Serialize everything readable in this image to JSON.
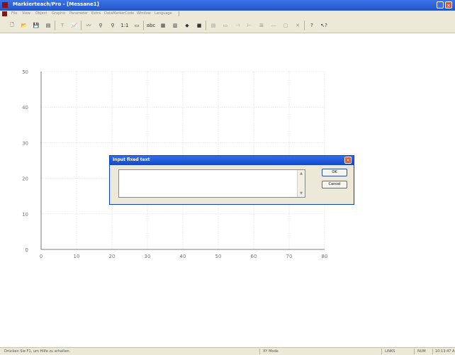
{
  "window": {
    "title": "Markierteach/Pro - [Messane1]",
    "minimize_glyph": "_",
    "close_glyph": "×"
  },
  "menu": {
    "items": [
      "File",
      "View",
      "Object",
      "Graphic",
      "Parameter",
      "Extra",
      "DataMarkerCode",
      "Window",
      "Language"
    ]
  },
  "toolbar": {
    "buttons": [
      {
        "name": "new-icon",
        "glyph": "🗋",
        "enabled": true
      },
      {
        "name": "open-icon",
        "glyph": "📂",
        "enabled": true
      },
      {
        "name": "save-icon",
        "glyph": "💾",
        "enabled": true
      },
      {
        "name": "import-icon",
        "glyph": "▤",
        "enabled": true
      },
      {
        "name": "text-tool-icon",
        "glyph": "T",
        "enabled": false
      },
      {
        "name": "chart-icon",
        "glyph": "📈",
        "enabled": true
      },
      {
        "name": "curve-icon",
        "glyph": "〰",
        "enabled": true
      },
      {
        "name": "zoom-icon",
        "glyph": "⚲",
        "enabled": true
      },
      {
        "name": "zoom-fit-icon",
        "glyph": "⚲",
        "enabled": true
      },
      {
        "name": "scale-1to1-icon",
        "glyph": "1:1",
        "enabled": true
      },
      {
        "name": "ruler-icon",
        "glyph": "▭",
        "enabled": true
      },
      {
        "name": "abc-icon",
        "glyph": "abc",
        "enabled": true
      },
      {
        "name": "grid-icon",
        "glyph": "▦",
        "enabled": true
      },
      {
        "name": "table-icon",
        "glyph": "▥",
        "enabled": true
      },
      {
        "name": "color-icon",
        "glyph": "◆",
        "enabled": true
      },
      {
        "name": "fill-icon",
        "glyph": "■",
        "enabled": true
      },
      {
        "name": "matrix-icon",
        "glyph": "▤",
        "enabled": false
      },
      {
        "name": "layers-icon",
        "glyph": "▭",
        "enabled": false
      },
      {
        "name": "align-left-icon",
        "glyph": "⊣",
        "enabled": false
      },
      {
        "name": "align-right-icon",
        "glyph": "⊢",
        "enabled": false
      },
      {
        "name": "distribute-icon",
        "glyph": "⊞",
        "enabled": false
      },
      {
        "name": "line-icon",
        "glyph": "—",
        "enabled": false
      },
      {
        "name": "box-icon",
        "glyph": "▢",
        "enabled": false
      },
      {
        "name": "delete-icon",
        "glyph": "✕",
        "enabled": false
      },
      {
        "name": "help-icon",
        "glyph": "?",
        "enabled": true
      },
      {
        "name": "context-help-icon",
        "glyph": "↖?",
        "enabled": true
      }
    ]
  },
  "chart_data": {
    "type": "scatter",
    "x_ticks": [
      "0",
      "10",
      "20",
      "30",
      "40",
      "50",
      "60",
      "70",
      "80"
    ],
    "y_ticks": [
      "0",
      "10",
      "20",
      "30",
      "40",
      "50"
    ],
    "xlim": [
      0,
      80
    ],
    "ylim": [
      0,
      50
    ],
    "grid": true,
    "series": []
  },
  "dialog": {
    "title": "Input fixed text",
    "text_value": "",
    "ok_label": "OK",
    "cancel_label": "Cancel",
    "close_glyph": "×",
    "scroll_up": "▲",
    "scroll_down": "▼"
  },
  "statusbar": {
    "help_text": "Drücken Sie F1, um Hilfe zu erhalten.",
    "mode": "XY Mode",
    "pane1": "LINKS",
    "pane2": "NUM",
    "time": "10:13:47 A"
  }
}
